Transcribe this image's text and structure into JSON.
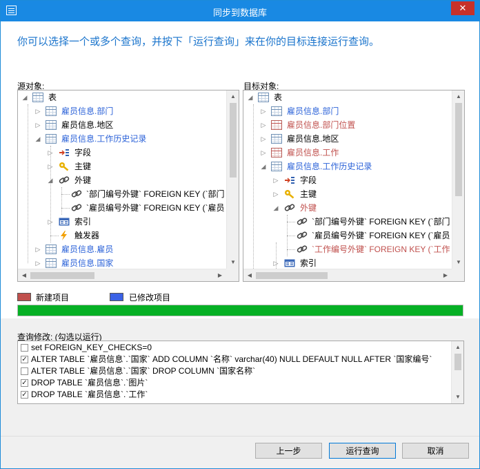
{
  "window": {
    "title": "同步到数据库",
    "close_glyph": "✕"
  },
  "instruction": "你可以选择一个或多个查询，并按下「运行查询」来在你的目标连接运行查询。",
  "source": {
    "label": "源对象:",
    "items": [
      {
        "label": "表",
        "icon": "table-icon",
        "color": "default"
      },
      {
        "label": "雇员信息.部门",
        "icon": "table-icon",
        "color": "blue"
      },
      {
        "label": "雇员信息.地区",
        "icon": "table-icon",
        "color": "default"
      },
      {
        "label": "雇员信息.工作历史记录",
        "icon": "table-icon",
        "color": "blue"
      },
      {
        "label": "字段",
        "icon": "field-icon",
        "color": "default"
      },
      {
        "label": "主键",
        "icon": "key-icon",
        "color": "default"
      },
      {
        "label": "外键",
        "icon": "link-icon",
        "color": "default"
      },
      {
        "label": "`部门编号外键` FOREIGN KEY (`部门",
        "icon": "link-icon",
        "color": "default"
      },
      {
        "label": "`雇员编号外键` FOREIGN KEY (`雇员",
        "icon": "link-icon",
        "color": "default"
      },
      {
        "label": "索引",
        "icon": "index-icon",
        "color": "default"
      },
      {
        "label": "触发器",
        "icon": "trigger-icon",
        "color": "default"
      },
      {
        "label": "雇员信息.雇员",
        "icon": "table-icon",
        "color": "blue"
      },
      {
        "label": "雇员信息.国家",
        "icon": "table-icon",
        "color": "blue"
      }
    ]
  },
  "target": {
    "label": "目标对象:",
    "items": [
      {
        "label": "表",
        "icon": "table-icon",
        "color": "default"
      },
      {
        "label": "雇员信息.部门",
        "icon": "table-icon",
        "color": "blue"
      },
      {
        "label": "雇员信息.部门位置",
        "icon": "table-icon",
        "color": "red"
      },
      {
        "label": "雇员信息.地区",
        "icon": "table-icon",
        "color": "default"
      },
      {
        "label": "雇员信息.工作",
        "icon": "table-icon",
        "color": "red"
      },
      {
        "label": "雇员信息.工作历史记录",
        "icon": "table-icon",
        "color": "blue"
      },
      {
        "label": "字段",
        "icon": "field-icon",
        "color": "default"
      },
      {
        "label": "主键",
        "icon": "key-icon",
        "color": "default"
      },
      {
        "label": "外键",
        "icon": "link-icon",
        "color": "red"
      },
      {
        "label": "`部门编号外键` FOREIGN KEY (`部门",
        "icon": "link-icon",
        "color": "default"
      },
      {
        "label": "`雇员编号外键` FOREIGN KEY (`雇员",
        "icon": "link-icon",
        "color": "default"
      },
      {
        "label": "`工作编号外键` FOREIGN KEY (`工作",
        "icon": "link-icon",
        "color": "red"
      },
      {
        "label": "索引",
        "icon": "index-icon",
        "color": "default"
      }
    ]
  },
  "legend": {
    "new_label": "新建项目",
    "modified_label": "已修改项目",
    "new_color": "#c0504d",
    "modified_color": "#3b62e6"
  },
  "progress": {
    "percent": 100,
    "color": "#06b025"
  },
  "queries": {
    "label": "查询修改: (勾选以运行)",
    "items": [
      {
        "text": "set FOREIGN_KEY_CHECKS=0",
        "checked": false
      },
      {
        "text": "ALTER TABLE `雇员信息`.`国家` ADD COLUMN `名称` varchar(40) NULL DEFAULT NULL AFTER `国家编号`",
        "checked": true
      },
      {
        "text": "ALTER TABLE `雇员信息`.`国家` DROP COLUMN `国家名称`",
        "checked": false
      },
      {
        "text": "DROP TABLE `雇员信息`.`图片`",
        "checked": true
      },
      {
        "text": "DROP TABLE `雇员信息`.`工作`",
        "checked": true
      }
    ]
  },
  "buttons": {
    "back": "上一步",
    "run": "运行查询",
    "cancel": "取消"
  }
}
